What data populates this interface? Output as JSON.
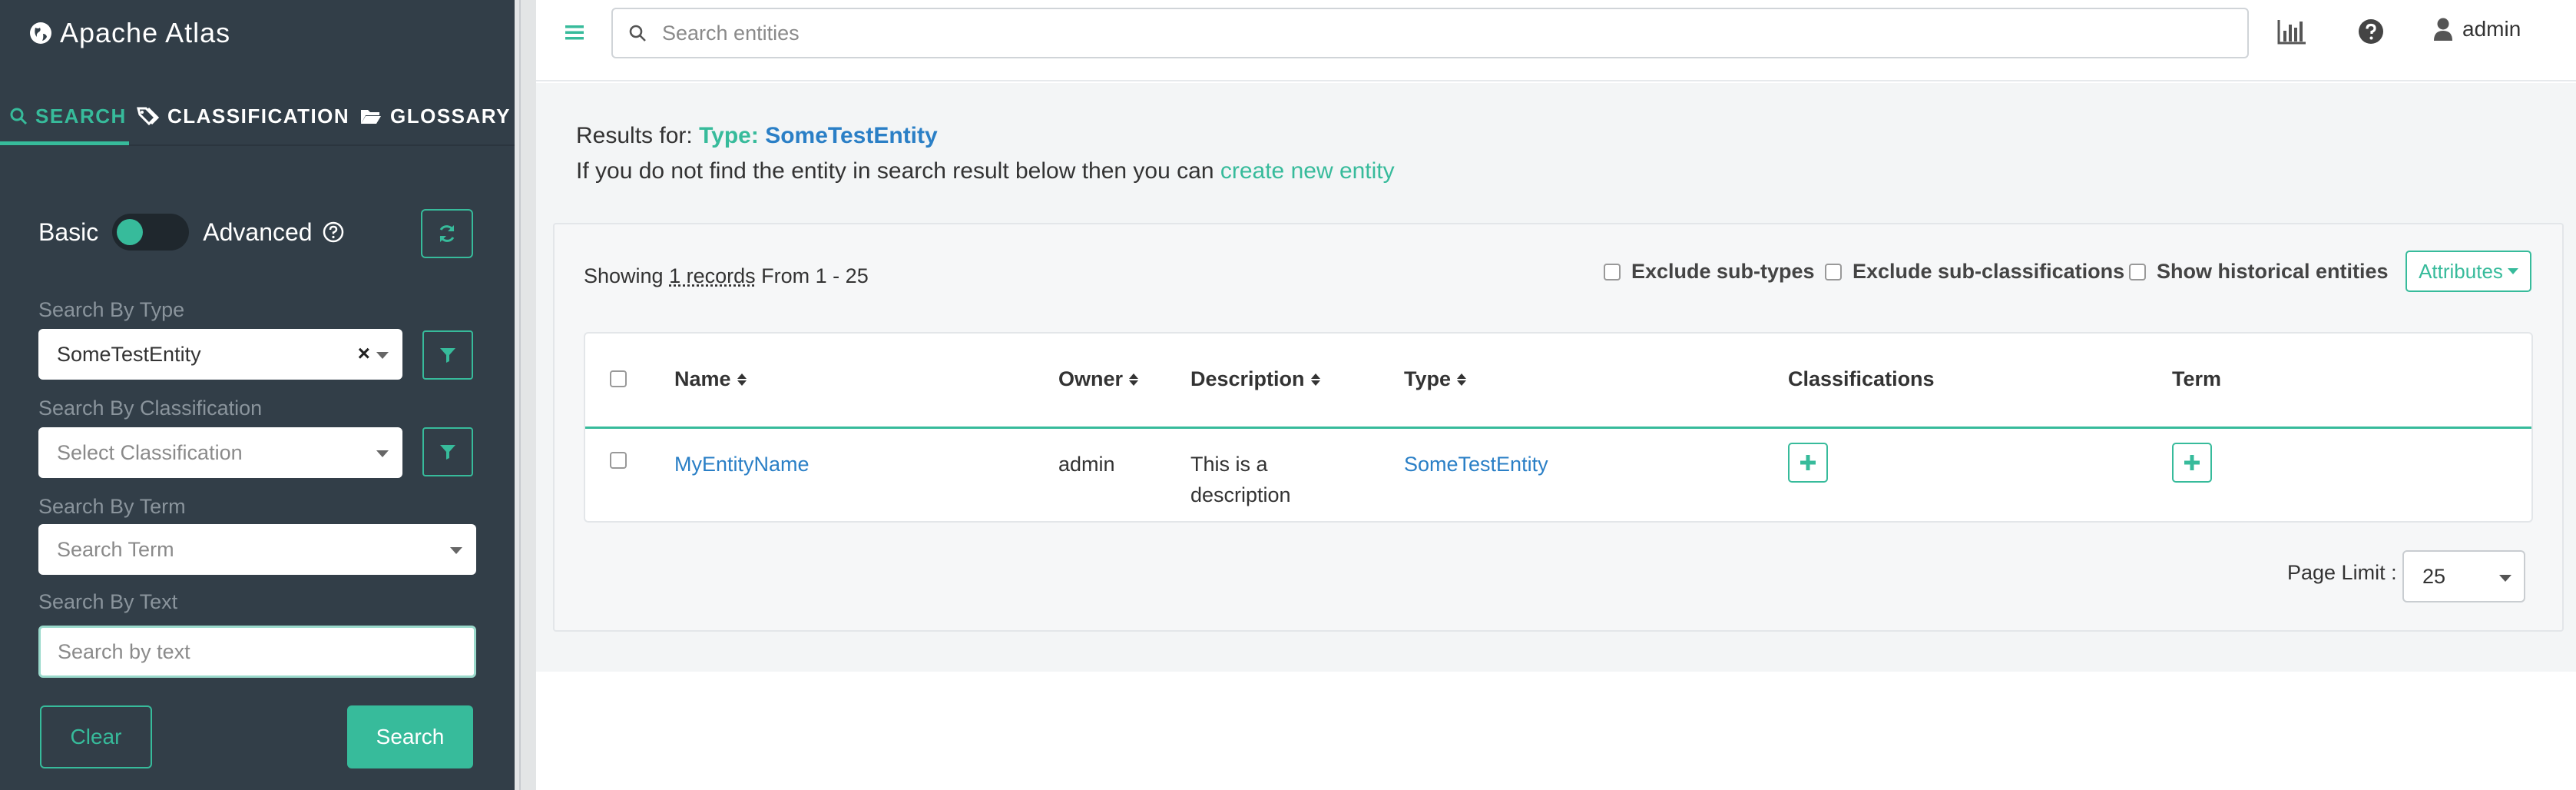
{
  "app": {
    "title": "Apache Atlas"
  },
  "sidebar": {
    "tabs": [
      {
        "label": "SEARCH",
        "icon": "search-icon",
        "active": true
      },
      {
        "label": "CLASSIFICATION",
        "icon": "tags-icon",
        "active": false
      },
      {
        "label": "GLOSSARY",
        "icon": "folder-open-icon",
        "active": false
      }
    ],
    "mode": {
      "basic_label": "Basic",
      "advanced_label": "Advanced",
      "advanced_enabled": false
    },
    "search_by_type": {
      "label": "Search By Type",
      "value": "SomeTestEntity"
    },
    "search_by_classification": {
      "label": "Search By Classification",
      "placeholder": "Select Classification"
    },
    "search_by_term": {
      "label": "Search By Term",
      "placeholder": "Search Term"
    },
    "search_by_text": {
      "label": "Search By Text",
      "placeholder": "Search by text",
      "value": ""
    },
    "clear_label": "Clear",
    "search_label": "Search"
  },
  "header": {
    "search_placeholder": "Search entities",
    "user": "admin"
  },
  "results": {
    "prefix": "Results for:",
    "type_label": "Type:",
    "type_value": "SomeTestEntity",
    "hint_text": "If you do not find the entity in search result below then you can",
    "hint_link": "create new entity",
    "showing_prefix": "Showing",
    "showing_count": "1 records",
    "showing_range": "From 1 - 25",
    "options": [
      {
        "label": "Exclude sub-types",
        "checked": false
      },
      {
        "label": "Exclude sub-classifications",
        "checked": false
      },
      {
        "label": "Show historical entities",
        "checked": false
      }
    ],
    "attributes_label": "Attributes",
    "columns": [
      "Name",
      "Owner",
      "Description",
      "Type",
      "Classifications",
      "Term"
    ],
    "rows": [
      {
        "name": "MyEntityName",
        "owner": "admin",
        "description_line1": "This is a",
        "description_line2": "description",
        "type": "SomeTestEntity"
      }
    ],
    "page_limit_label": "Page Limit :",
    "page_limit_value": "25"
  },
  "colors": {
    "accent": "#37bb9b",
    "sidebar_bg": "#323e48",
    "link": "#2a7fc6"
  }
}
